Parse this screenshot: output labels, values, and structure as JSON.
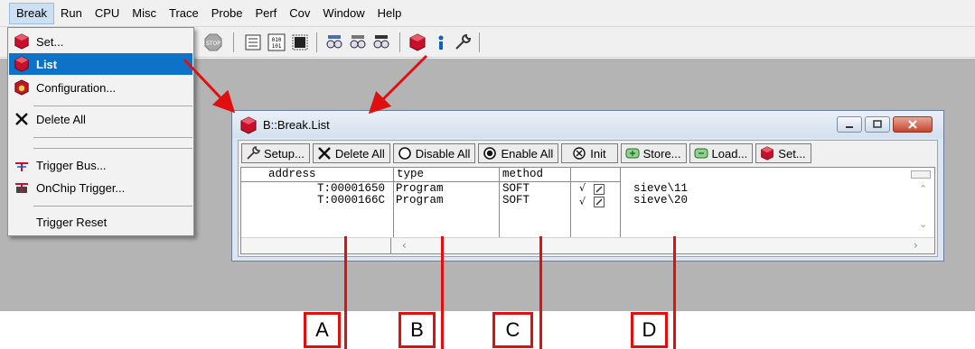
{
  "menubar": {
    "items": [
      "Break",
      "Run",
      "CPU",
      "Misc",
      "Trace",
      "Probe",
      "Perf",
      "Cov",
      "Window",
      "Help"
    ],
    "active": "Break"
  },
  "break_menu": {
    "items": [
      {
        "label": "Set...",
        "icon": "breakpoint-icon",
        "selected": false
      },
      {
        "label": "List",
        "icon": "breakpoint-icon",
        "selected": true
      },
      {
        "label": "Configuration...",
        "icon": "breakpoint-config-icon",
        "selected": false
      },
      {
        "label": "Delete All",
        "icon": "delete-x-icon",
        "selected": false
      },
      {
        "label": "Trigger Bus...",
        "icon": "trigger-bus-icon",
        "selected": false
      },
      {
        "label": "OnChip Trigger...",
        "icon": "onchip-trigger-icon",
        "selected": false
      },
      {
        "label": "Trigger Reset",
        "icon": "",
        "selected": false
      }
    ]
  },
  "window": {
    "title": "B::Break.List",
    "buttons": [
      {
        "label": "Setup...",
        "icon": "wrench-icon"
      },
      {
        "label": "Delete All",
        "icon": "delete-x-icon"
      },
      {
        "label": "Disable All",
        "icon": "radio-empty-icon"
      },
      {
        "label": "Enable All",
        "icon": "radio-filled-icon"
      },
      {
        "label": "Init",
        "icon": "init-circle-icon"
      },
      {
        "label": "Store...",
        "icon": "store-icon"
      },
      {
        "label": "Load...",
        "icon": "load-icon"
      },
      {
        "label": "Set...",
        "icon": "breakpoint-icon"
      }
    ],
    "columns": [
      "address",
      "type",
      "method"
    ],
    "rows": [
      {
        "address": "T:00001650",
        "type": "Program",
        "method": "SOFT",
        "flag": "√",
        "symbol": "sieve\\11"
      },
      {
        "address": "T:0000166C",
        "type": "Program",
        "method": "SOFT",
        "flag": "√",
        "symbol": "sieve\\20"
      }
    ]
  },
  "callouts": [
    "A",
    "B",
    "C",
    "D"
  ],
  "colors": {
    "callout": "#e01010",
    "menu_highlight": "#0d72c8",
    "desktop": "#b4b4b4"
  }
}
